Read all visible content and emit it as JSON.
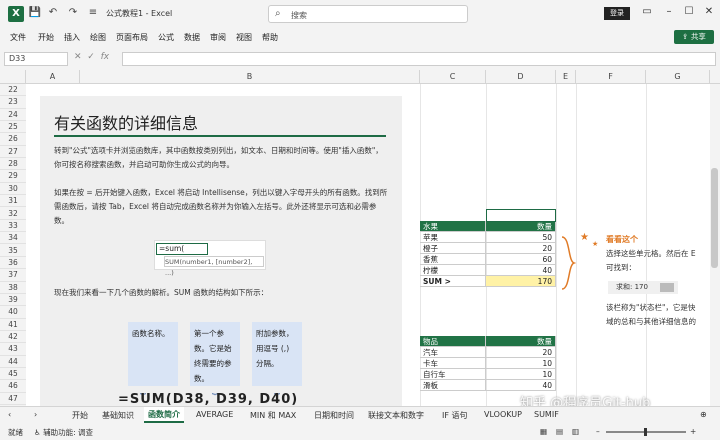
{
  "titlebar": {
    "doc_title": "公式教程1 - Excel",
    "search_placeholder": "搜索",
    "login": "登录"
  },
  "menu": [
    "文件",
    "开始",
    "插入",
    "绘图",
    "页面布局",
    "公式",
    "数据",
    "审阅",
    "视图",
    "帮助"
  ],
  "share_label": "共享",
  "formula_bar": {
    "name_box": "D33",
    "fx": "fx",
    "value": ""
  },
  "columns": [
    {
      "name": "A"
    },
    {
      "name": "B"
    },
    {
      "name": "C"
    },
    {
      "name": "D"
    },
    {
      "name": "E"
    },
    {
      "name": "F"
    },
    {
      "name": "G"
    }
  ],
  "rows": [
    "22",
    "23",
    "24",
    "25",
    "26",
    "27",
    "28",
    "29",
    "30",
    "31",
    "32",
    "33",
    "34",
    "35",
    "36",
    "37",
    "38",
    "39",
    "40",
    "41",
    "42",
    "43",
    "44",
    "45",
    "46",
    "47"
  ],
  "info": {
    "title": "有关函数的详细信息",
    "p1": "转到\"公式\"选项卡并浏览函数库，其中函数按类别列出，如文本、日期和时间等。使用\"插入函数\"，你可按名称搜索函数，并启动可助你生成公式的向导。",
    "p2": "如果在按 = 后开始键入函数，Excel 将启动 Intellisense，列出以键入字母开头的所有函数。找到所需函数后，请按 Tab，Excel 将自动完成函数名称并为你输入左括号。此外还将显示可选和必需参数。",
    "sum_cell": "=sum(",
    "sum_tip": "SUM(number1, [number2], ...)",
    "p3": "现在我们来看一下几个函数的解析。SUM 函数的结构如下所示：",
    "callouts": [
      "函数名称。",
      "第一个参数。它是始终需要的参数。",
      "附加参数，用逗号 (,) 分隔。"
    ],
    "partial_formula": "=SUM(D38, D39, D40)"
  },
  "fruit_table": {
    "headers": [
      "水果",
      "数量"
    ],
    "rows": [
      [
        "苹果",
        "50"
      ],
      [
        "橙子",
        "20"
      ],
      [
        "香蕉",
        "60"
      ],
      [
        "柠檬",
        "40"
      ]
    ],
    "sum_label": "SUM >",
    "sum_value": "170"
  },
  "item_table": {
    "headers": [
      "物品",
      "数量"
    ],
    "rows": [
      [
        "汽车",
        "20"
      ],
      [
        "卡车",
        "10"
      ],
      [
        "自行车",
        "10"
      ],
      [
        "滑板",
        "40"
      ]
    ]
  },
  "annotation": {
    "star": "看看这个",
    "line1": "选择这些单元格。然后在 E",
    "line2": "可找到：",
    "status_sum": "求和: 170",
    "line3": "该栏称为\"状态栏\"，它是快",
    "line4": "域的总和与其他详细信息的"
  },
  "tabs": [
    "开始",
    "基础知识",
    "函数简介",
    "AVERAGE",
    "MIN 和 MAX",
    "日期和时间",
    "联接文本和数字",
    "IF 语句",
    "VLOOKUP",
    "SUMIF"
  ],
  "active_tab": "函数简介",
  "status": {
    "ready": "就绪",
    "accessibility": "辅助功能: 调查"
  },
  "watermark": "知乎 @程序员Git-hub",
  "colors": {
    "accent": "#217346",
    "sum_highlight": "#fff2a6",
    "callout": "#d9e4f5",
    "orange": "#e07b27"
  }
}
